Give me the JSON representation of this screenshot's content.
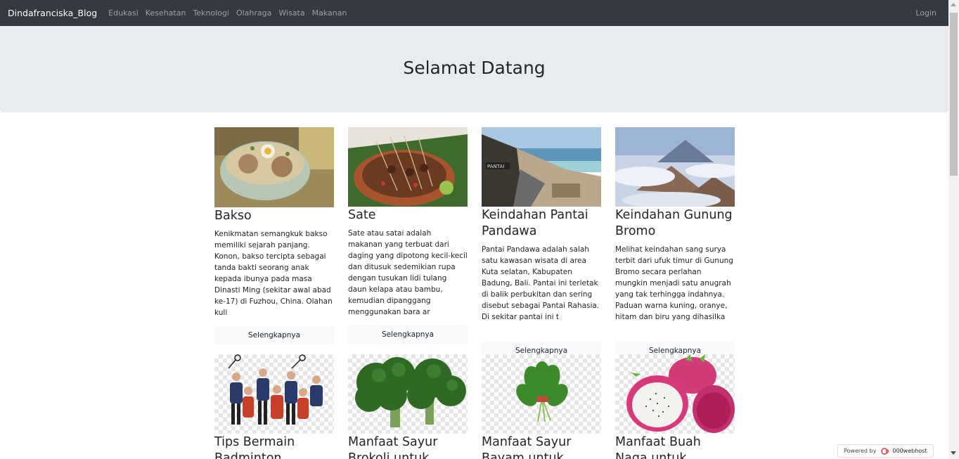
{
  "navbar": {
    "brand": "Dindafranciska_Blog",
    "links": [
      "Edukasi",
      "Kesehatan",
      "Teknologi",
      "Olahraga",
      "Wisata",
      "Makanan"
    ],
    "login": "Login"
  },
  "jumbotron": {
    "title": "Selamat Datang"
  },
  "cards": [
    {
      "title": "Bakso",
      "text": "Kenikmatan semangkuk bakso memiliki sejarah panjang. Konon, bakso tercipta sebagai tanda bakti seorang anak kepada ibunya pada masa Dinasti Ming (sekitar awal abad ke-17) di Fuzhou, China. Olahan kuli",
      "button": "Selengkapnya"
    },
    {
      "title": "Sate",
      "text": "Sate atau satai adalah makanan yang terbuat dari daging yang dipotong kecil-kecil dan ditusuk sedemikian rupa dengan tusukan lidi tulang daun kelapa atau bambu, kemudian dipanggang menggunakan bara ar",
      "button": "Selengkapnya"
    },
    {
      "title": "Keindahan Pantai Pandawa",
      "text": "Pantai Pandawa adalah salah satu kawasan wisata di area Kuta selatan, Kabupaten Badung, Bali. Pantai ini terletak di balik perbukitan dan sering disebut sebagai Pantai Rahasia. Di sekitar pantai ini t",
      "button": "Selengkapnya"
    },
    {
      "title": "Keindahan Gunung Bromo",
      "text": "Melihat keindahan sang surya terbit dari ufuk timur di Gunung Bromo secara perlahan mungkin menjadi satu anugrah yang tak terhingga indahnya. Paduan warna kuning, oranye, hitam dan biru yang dihasilka",
      "button": "Selengkapnya"
    },
    {
      "title": "Tips Bermain Badminton"
    },
    {
      "title": "Manfaat Sayur Brokoli untuk"
    },
    {
      "title": "Manfaat Sayur Bayam untuk"
    },
    {
      "title": "Manfaat Buah Naga untuk"
    }
  ],
  "powered": {
    "prefix": "Powered by",
    "host": "000webhost"
  }
}
